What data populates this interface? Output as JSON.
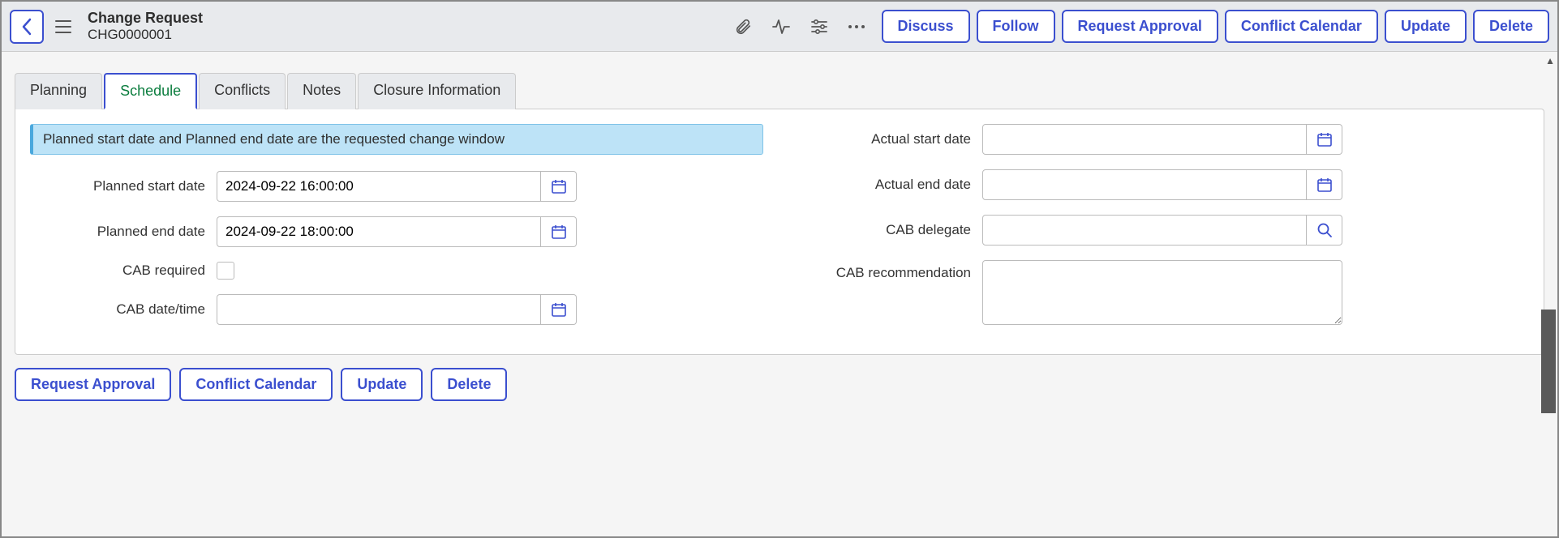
{
  "header": {
    "title": "Change Request",
    "record_number": "CHG0000001",
    "buttons": {
      "discuss": "Discuss",
      "follow": "Follow",
      "request_approval": "Request Approval",
      "conflict_calendar": "Conflict Calendar",
      "update": "Update",
      "delete": "Delete"
    }
  },
  "tabs": {
    "planning": "Planning",
    "schedule": "Schedule",
    "conflicts": "Conflicts",
    "notes": "Notes",
    "closure": "Closure Information"
  },
  "banner": "Planned start date and Planned end date are the requested change window",
  "fields": {
    "planned_start": {
      "label": "Planned start date",
      "value": "2024-09-22 16:00:00"
    },
    "planned_end": {
      "label": "Planned end date",
      "value": "2024-09-22 18:00:00"
    },
    "cab_required": {
      "label": "CAB required"
    },
    "cab_datetime": {
      "label": "CAB date/time",
      "value": ""
    },
    "actual_start": {
      "label": "Actual start date",
      "value": ""
    },
    "actual_end": {
      "label": "Actual end date",
      "value": ""
    },
    "cab_delegate": {
      "label": "CAB delegate",
      "value": ""
    },
    "cab_recommendation": {
      "label": "CAB recommendation",
      "value": ""
    }
  },
  "bottom_buttons": {
    "request_approval": "Request Approval",
    "conflict_calendar": "Conflict Calendar",
    "update": "Update",
    "delete": "Delete"
  }
}
